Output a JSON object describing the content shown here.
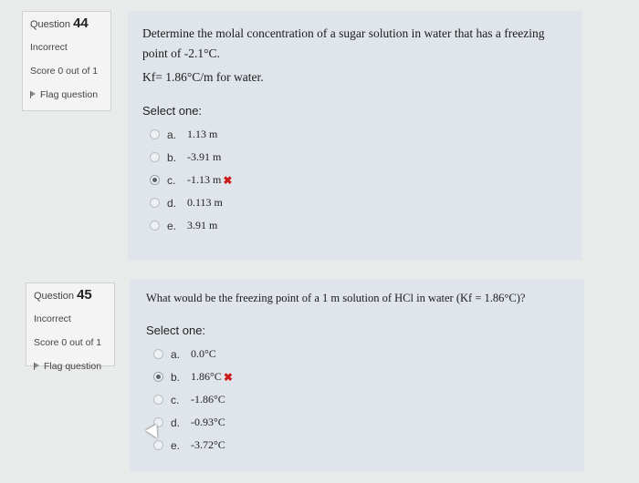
{
  "questions": [
    {
      "label": "Question",
      "number": "44",
      "status": "Incorrect",
      "score": "Score 0 out of 1",
      "flag": "Flag question",
      "text_line1": "Determine the molal concentration of a sugar solution in water that has a freezing",
      "text_line2": "point of -2.1°C.",
      "text_line3": "Kf= 1.86°C/m for water.",
      "select_label": "Select one:",
      "options": [
        {
          "letter": "a.",
          "value": "1.13 m"
        },
        {
          "letter": "b.",
          "value": "-3.91 m"
        },
        {
          "letter": "c.",
          "value": "-1.13 m"
        },
        {
          "letter": "d.",
          "value": "0.113 m"
        },
        {
          "letter": "e.",
          "value": "3.91 m"
        }
      ],
      "selected": "c",
      "wrong_mark": "✖"
    },
    {
      "label": "Question",
      "number": "45",
      "status": "Incorrect",
      "score": "Score 0 out of 1",
      "flag": "Flag question",
      "text_line1": "What would be the freezing point of a 1 m solution of HCl in water (Kf = 1.86°C)?",
      "select_label": "Select one:",
      "options": [
        {
          "letter": "a.",
          "value": "0.0°C"
        },
        {
          "letter": "b.",
          "value": "1.86°C"
        },
        {
          "letter": "c.",
          "value": "-1.86°C"
        },
        {
          "letter": "d.",
          "value": "-0.93°C"
        },
        {
          "letter": "e.",
          "value": "-3.72°C"
        }
      ],
      "selected": "b",
      "wrong_mark": "✖"
    }
  ],
  "icons": {
    "flag": "flag-icon",
    "cursor": "mouse-pointer-icon",
    "wrong": "x-mark-icon"
  },
  "colors": {
    "wrong": "#cc1a1a",
    "content_bg": "#dfe5ea",
    "info_bg": "#f4f4f4"
  }
}
